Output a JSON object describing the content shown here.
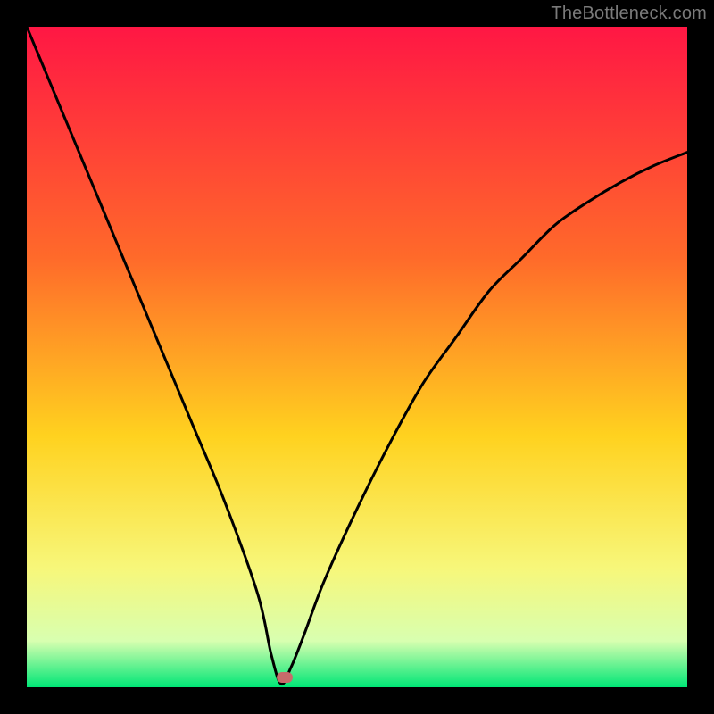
{
  "watermark": "TheBottleneck.com",
  "colors": {
    "top": "#ff1744",
    "upper_mid": "#ff6a2a",
    "mid": "#ffd21f",
    "lower_mid": "#f7f77a",
    "near_bottom": "#d8ffb0",
    "bottom": "#00e676",
    "curve": "#000000",
    "marker": "#c76b6b"
  },
  "chart_data": {
    "type": "line",
    "title": "",
    "xlabel": "",
    "ylabel": "",
    "xlim": [
      0,
      100
    ],
    "ylim": [
      0,
      100
    ],
    "legend": false,
    "grid": false,
    "series": [
      {
        "name": "bottleneck-curve",
        "x": [
          0,
          5,
          10,
          15,
          20,
          25,
          30,
          35,
          37,
          38.5,
          40,
          42,
          45,
          50,
          55,
          60,
          65,
          70,
          75,
          80,
          85,
          90,
          95,
          100
        ],
        "values": [
          100,
          88,
          76,
          64,
          52,
          40,
          28,
          14,
          5,
          0.5,
          3,
          8,
          16,
          27,
          37,
          46,
          53,
          60,
          65,
          70,
          73.5,
          76.5,
          79,
          81
        ]
      }
    ],
    "annotations": [
      {
        "type": "marker",
        "x": 39,
        "y": 1.5,
        "label": "optimal-point"
      }
    ],
    "gradient_stops": [
      {
        "offset": 0.0,
        "color": "#ff1744"
      },
      {
        "offset": 0.35,
        "color": "#ff6a2a"
      },
      {
        "offset": 0.62,
        "color": "#ffd21f"
      },
      {
        "offset": 0.82,
        "color": "#f7f77a"
      },
      {
        "offset": 0.93,
        "color": "#d8ffb0"
      },
      {
        "offset": 1.0,
        "color": "#00e676"
      }
    ]
  }
}
